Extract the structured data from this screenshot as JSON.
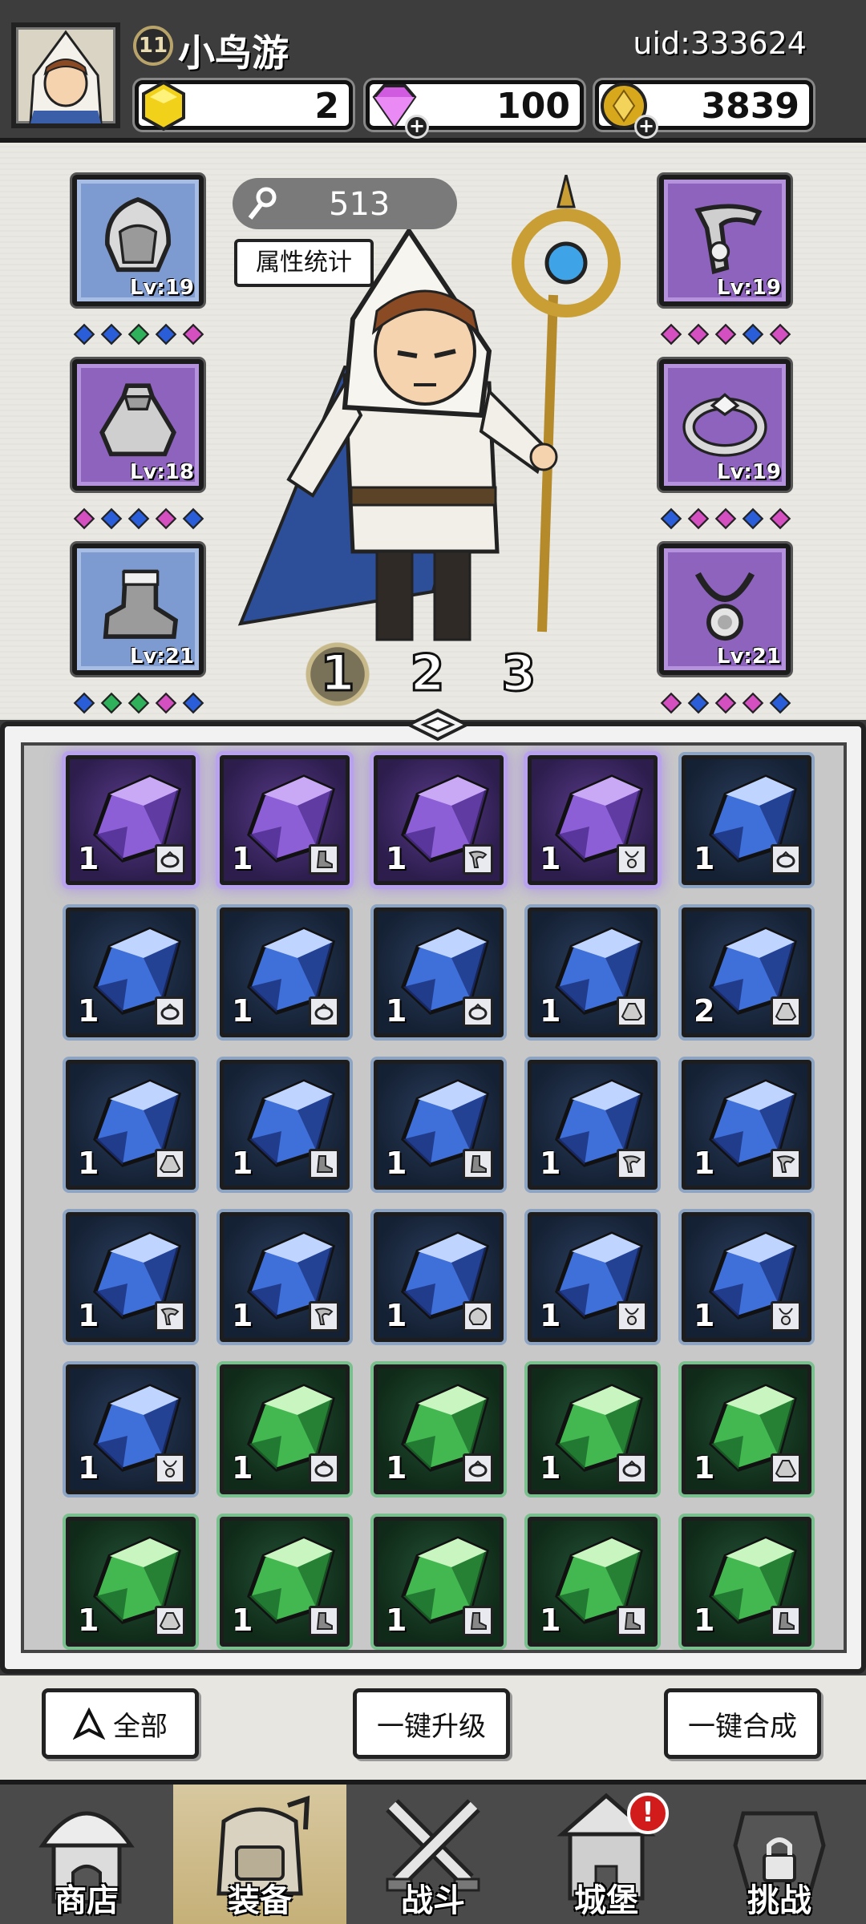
{
  "player": {
    "level": "11",
    "name": "小鸟游",
    "uid": "uid:333624"
  },
  "currencies": [
    {
      "name": "gold-hex",
      "value": "2",
      "color": "#f2d11a"
    },
    {
      "name": "diamond",
      "value": "100",
      "color": "#d05be0"
    },
    {
      "name": "coin",
      "value": "3839",
      "color": "#d8a81c"
    }
  ],
  "equipment": {
    "power": "513",
    "stats_button": "属性统计",
    "slots": [
      {
        "name": "helmet",
        "level": "Lv:19",
        "rarity": "blue"
      },
      {
        "name": "cape",
        "level": "Lv:18",
        "rarity": "purple"
      },
      {
        "name": "boots",
        "level": "Lv:21",
        "rarity": "blue"
      },
      {
        "name": "pauldron",
        "level": "Lv:19",
        "rarity": "purple"
      },
      {
        "name": "ring",
        "level": "Lv:19",
        "rarity": "purple"
      },
      {
        "name": "amulet",
        "level": "Lv:21",
        "rarity": "purple"
      }
    ],
    "gem_rows": [
      [
        "b",
        "b",
        "g",
        "b",
        "p"
      ],
      [
        "p",
        "b",
        "b",
        "p",
        "b"
      ],
      [
        "b",
        "g",
        "g",
        "p",
        "b"
      ],
      [
        "p",
        "p",
        "p",
        "b",
        "p"
      ],
      [
        "b",
        "p",
        "p",
        "b",
        "p"
      ],
      [
        "p",
        "b",
        "p",
        "p",
        "b"
      ]
    ],
    "loadouts": [
      "1",
      "2",
      "3"
    ],
    "active_loadout": "1"
  },
  "inventory": {
    "rows": [
      [
        {
          "rarity": "purple",
          "qty": "1",
          "type": "ring"
        },
        {
          "rarity": "purple",
          "qty": "1",
          "type": "boots"
        },
        {
          "rarity": "purple",
          "qty": "1",
          "type": "pauldron"
        },
        {
          "rarity": "purple",
          "qty": "1",
          "type": "amulet"
        },
        {
          "rarity": "blue",
          "qty": "1",
          "type": "ring"
        }
      ],
      [
        {
          "rarity": "blue",
          "qty": "1",
          "type": "ring"
        },
        {
          "rarity": "blue",
          "qty": "1",
          "type": "ring"
        },
        {
          "rarity": "blue",
          "qty": "1",
          "type": "ring"
        },
        {
          "rarity": "blue",
          "qty": "1",
          "type": "cape"
        },
        {
          "rarity": "blue",
          "qty": "2",
          "type": "cape"
        }
      ],
      [
        {
          "rarity": "blue",
          "qty": "1",
          "type": "cape"
        },
        {
          "rarity": "blue",
          "qty": "1",
          "type": "boots"
        },
        {
          "rarity": "blue",
          "qty": "1",
          "type": "boots"
        },
        {
          "rarity": "blue",
          "qty": "1",
          "type": "pauldron"
        },
        {
          "rarity": "blue",
          "qty": "1",
          "type": "pauldron"
        }
      ],
      [
        {
          "rarity": "blue",
          "qty": "1",
          "type": "pauldron"
        },
        {
          "rarity": "blue",
          "qty": "1",
          "type": "pauldron"
        },
        {
          "rarity": "blue",
          "qty": "1",
          "type": "helmet"
        },
        {
          "rarity": "blue",
          "qty": "1",
          "type": "amulet"
        },
        {
          "rarity": "blue",
          "qty": "1",
          "type": "amulet"
        }
      ],
      [
        {
          "rarity": "blue",
          "qty": "1",
          "type": "amulet"
        },
        {
          "rarity": "green",
          "qty": "1",
          "type": "ring"
        },
        {
          "rarity": "green",
          "qty": "1",
          "type": "ring"
        },
        {
          "rarity": "green",
          "qty": "1",
          "type": "ring"
        },
        {
          "rarity": "green",
          "qty": "1",
          "type": "cape"
        }
      ],
      [
        {
          "rarity": "green",
          "qty": "1",
          "type": "cape"
        },
        {
          "rarity": "green",
          "qty": "1",
          "type": "boots"
        },
        {
          "rarity": "green",
          "qty": "1",
          "type": "boots"
        },
        {
          "rarity": "green",
          "qty": "1",
          "type": "boots"
        },
        {
          "rarity": "green",
          "qty": "1",
          "type": "boots"
        }
      ]
    ]
  },
  "actions": {
    "filter": "全部",
    "upgrade_all": "一键升级",
    "merge_all": "一键合成"
  },
  "nav": [
    {
      "key": "shop",
      "label": "商店",
      "icon": "shop-icon",
      "active": false,
      "alert": false
    },
    {
      "key": "equip",
      "label": "装备",
      "icon": "backpack-icon",
      "active": true,
      "alert": false
    },
    {
      "key": "battle",
      "label": "战斗",
      "icon": "crossed-swords-icon",
      "active": false,
      "alert": false
    },
    {
      "key": "castle",
      "label": "城堡",
      "icon": "castle-icon",
      "active": false,
      "alert": true
    },
    {
      "key": "challenge",
      "label": "挑战",
      "icon": "locked-armor-icon",
      "active": false,
      "alert": false
    }
  ],
  "alert_mark": "!",
  "colors": {
    "purple": "#8d63bd",
    "blue": "#2a5ed8",
    "green": "#2fb05a",
    "gold": "#c9a94a"
  }
}
